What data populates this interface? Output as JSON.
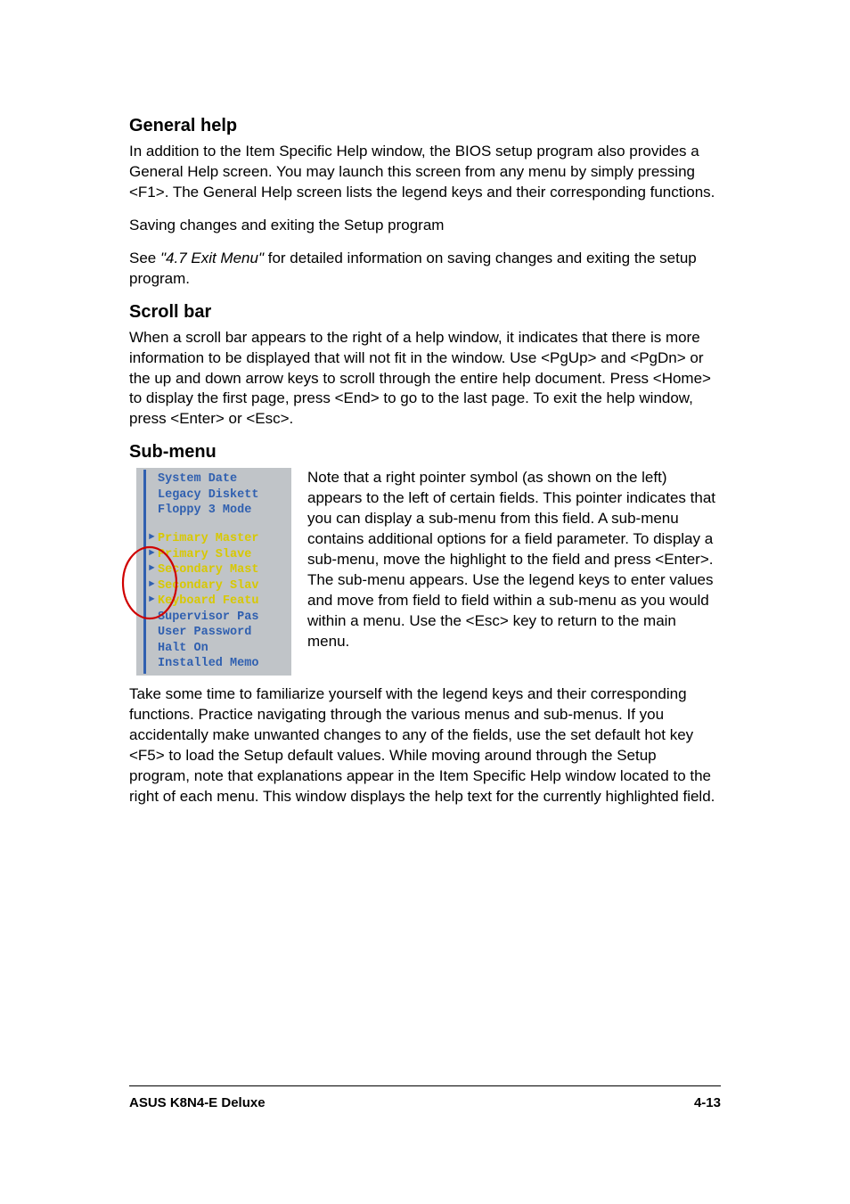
{
  "sections": {
    "general_help": {
      "heading": "General help",
      "p1": "In addition to the Item Specific Help window, the BIOS setup program also provides a General Help screen. You may launch this screen from any menu by simply pressing <F1>. The General Help screen lists the legend keys and their corresponding functions.",
      "p2": "Saving changes and exiting the Setup program",
      "p3_pre": "See ",
      "p3_italic": "\"4.7 Exit Menu\"",
      "p3_post": " for detailed information on saving changes and exiting the setup program."
    },
    "scroll_bar": {
      "heading": "Scroll bar",
      "p1": "When a scroll bar appears to the right of a help window, it indicates that there is more information to be displayed that will not fit in the window. Use <PgUp> and <PgDn> or the up and down arrow keys to scroll through the entire help document. Press <Home> to display the first page, press <End> to go to the last page. To exit the help window, press <Enter> or <Esc>."
    },
    "sub_menu": {
      "heading": "Sub-menu",
      "p1": "Note that a right pointer symbol (as shown on the left) appears to the left of certain fields. This pointer indicates that you can display a sub-menu from this field. A sub-menu contains additional options for a field parameter. To display a sub-menu, move the highlight to the field and press <Enter>. The sub-menu appears. Use the legend keys to enter values and move from field to field within a sub-menu as you would within a menu. Use the <Esc> key to return to the main menu.",
      "p2": "Take some time to familiarize yourself with the legend keys and their corresponding functions. Practice navigating through the various menus and sub-menus. If you accidentally make unwanted changes to any of the fields, use the set default hot key <F5> to load the Setup default values. While moving around through the Setup program, note that explanations appear in the Item Specific Help window located to the right of each menu. This window displays the help text for the currently highlighted field."
    }
  },
  "bios": {
    "line1": "System Date",
    "line2": "Legacy Diskett",
    "line3": "Floppy 3 Mode",
    "line4": "Primary Master",
    "line5": "Primary Slave",
    "line6": "Secondary Mast",
    "line7": "Secondary Slav",
    "line8": "Keyboard Featu",
    "line9": "Supervisor Pas",
    "line10": "User Password",
    "line11": "Halt On",
    "line12": "Installed Memo"
  },
  "footer": {
    "left": "ASUS K8N4-E Deluxe",
    "right": "4-13"
  }
}
